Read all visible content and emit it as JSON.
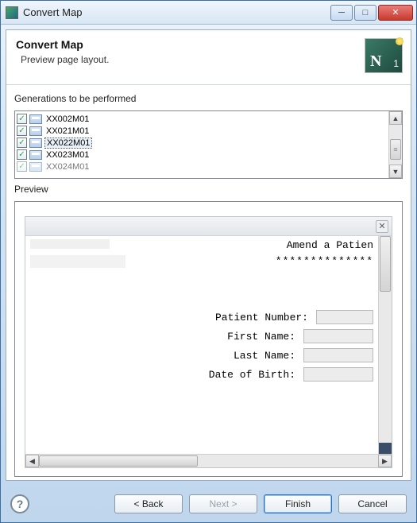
{
  "window": {
    "title": "Convert Map"
  },
  "header": {
    "title": "Convert Map",
    "subtitle": "Preview page layout."
  },
  "generations": {
    "label": "Generations to be performed",
    "items": [
      {
        "label": "XX002M01",
        "checked": true,
        "selected": false
      },
      {
        "label": "XX021M01",
        "checked": true,
        "selected": false
      },
      {
        "label": "XX022M01",
        "checked": true,
        "selected": true
      },
      {
        "label": "XX023M01",
        "checked": true,
        "selected": false
      },
      {
        "label": "XX024M01",
        "checked": true,
        "selected": false,
        "cut": true
      }
    ]
  },
  "preview": {
    "label": "Preview",
    "heading": "Amend a Patien",
    "stars": "**************",
    "fields": {
      "patient_number": "Patient Number:",
      "first_name": "First Name:",
      "last_name": "Last Name:",
      "dob": "Date of Birth:"
    }
  },
  "buttons": {
    "back": "< Back",
    "next": "Next >",
    "finish": "Finish",
    "cancel": "Cancel"
  }
}
